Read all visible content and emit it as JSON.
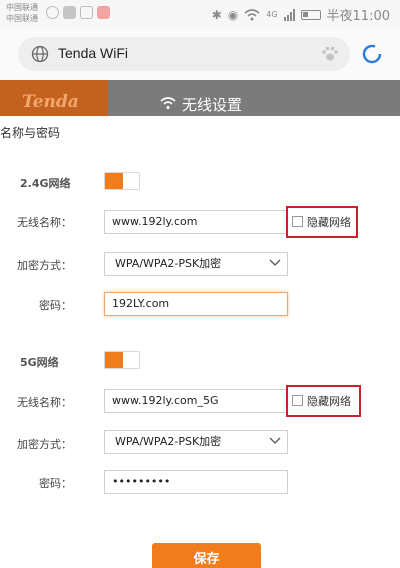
{
  "status_bar": {
    "carrier_line1": "中国联通",
    "carrier_line2": "中国联通",
    "network": "4G",
    "time": "半夜11:00",
    "icons": [
      "bluetooth-icon",
      "eye-icon",
      "wifi-icon",
      "signal-icon",
      "battery-icon"
    ]
  },
  "address_bar": {
    "url": "Tenda WiFi",
    "icons": [
      "globe-icon",
      "paw-icon",
      "reload-icon"
    ]
  },
  "router_header": {
    "logo": "Tenda",
    "page_title": "无线设置"
  },
  "section": {
    "title": "名称与密码"
  },
  "band_24": {
    "label": "2.4G网络",
    "enabled": true,
    "ssid_label": "无线名称：",
    "ssid_value": "www.192ly.com",
    "hide_label": "隐藏网络",
    "hide_checked": false,
    "encryption_label": "加密方式：",
    "encryption_value": "WPA/WPA2-PSK加密",
    "password_label": "密码：",
    "password_value": "192LY.com"
  },
  "band_5": {
    "label": "5G网络",
    "enabled": true,
    "ssid_label": "无线名称：",
    "ssid_value": "www.192ly.com_5G",
    "hide_label": "隐藏网络",
    "hide_checked": false,
    "encryption_label": "加密方式：",
    "encryption_value": "WPA/WPA2-PSK加密",
    "password_label": "密码：",
    "password_value": "•••••••••"
  },
  "actions": {
    "save_label": "保存"
  },
  "colors": {
    "accent": "#f07c1c",
    "header_bg": "#7b7b7b",
    "logo_bg": "#c2621e",
    "highlight_box": "#c8232c"
  }
}
